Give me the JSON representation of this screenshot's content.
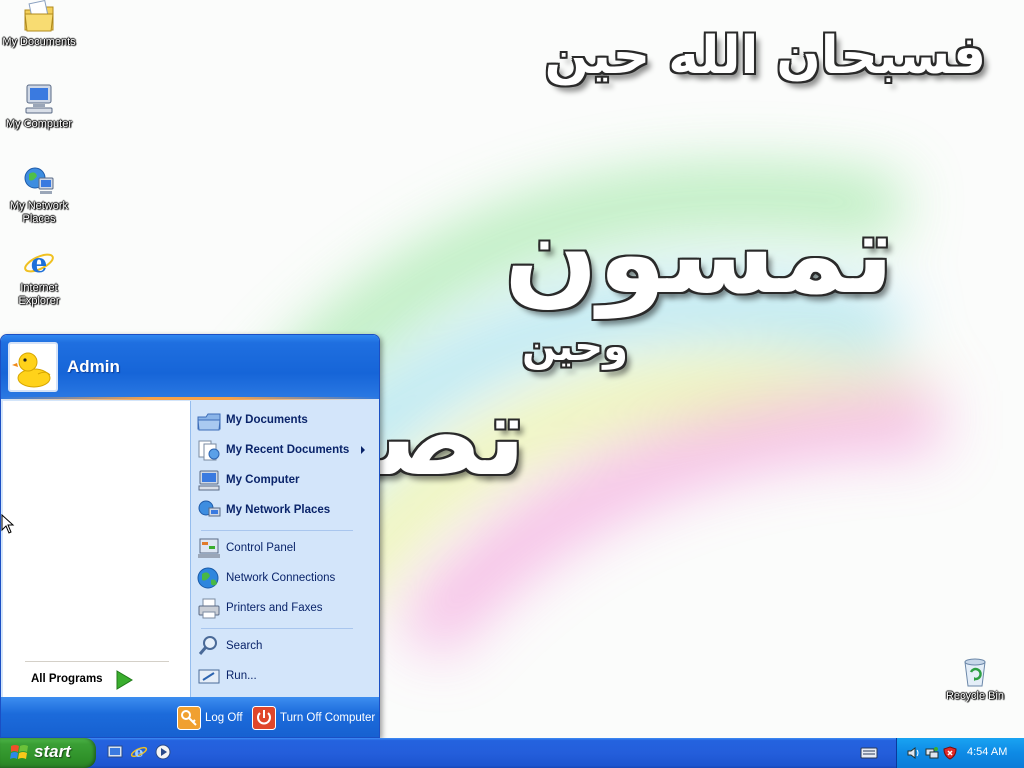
{
  "wallpaper": {
    "line1": "فسبحان الله حين",
    "line2": "تمسون",
    "line3": "وحين",
    "line4": "تصبحون"
  },
  "desktop_icons": [
    {
      "label": "My Documents",
      "icon": "folder-documents-icon"
    },
    {
      "label": "My Computer",
      "icon": "computer-icon"
    },
    {
      "label": "My Network Places",
      "icon": "network-places-icon"
    },
    {
      "label": "Internet Explorer",
      "icon": "internet-explorer-icon"
    },
    {
      "label": "Recycle Bin",
      "icon": "recycle-bin-icon"
    }
  ],
  "start_menu": {
    "user_name": "Admin",
    "all_programs_label": "All Programs",
    "right_items": [
      {
        "label": "My Documents",
        "bold": true,
        "icon": "my-documents-icon"
      },
      {
        "label": "My Recent Documents",
        "bold": true,
        "icon": "recent-documents-icon",
        "submenu": true
      },
      {
        "label": "My Computer",
        "bold": true,
        "icon": "my-computer-icon"
      },
      {
        "label": "My Network Places",
        "bold": true,
        "icon": "network-places-icon"
      },
      {
        "label": "Control Panel",
        "bold": false,
        "icon": "control-panel-icon"
      },
      {
        "label": "Network Connections",
        "bold": false,
        "icon": "network-connections-icon"
      },
      {
        "label": "Printers and Faxes",
        "bold": false,
        "icon": "printers-faxes-icon"
      },
      {
        "label": "Search",
        "bold": false,
        "icon": "search-icon"
      },
      {
        "label": "Run...",
        "bold": false,
        "icon": "run-icon"
      }
    ],
    "log_off_label": "Log Off",
    "turn_off_label": "Turn Off Computer"
  },
  "taskbar": {
    "start_label": "start",
    "quick_launch": [
      "show-desktop-icon",
      "internet-explorer-icon",
      "media-player-icon"
    ],
    "tray_icons": [
      "keyboard-icon",
      "volume-icon",
      "network-icon",
      "security-shield-icon"
    ],
    "clock": "4:54 AM"
  },
  "colors": {
    "taskbar_blue": "#245edb",
    "start_green": "#3a9f35",
    "menu_header_blue": "#1665d8",
    "menu_right_panel": "#d3e5fa",
    "tray_blue": "#0e8ae5"
  }
}
